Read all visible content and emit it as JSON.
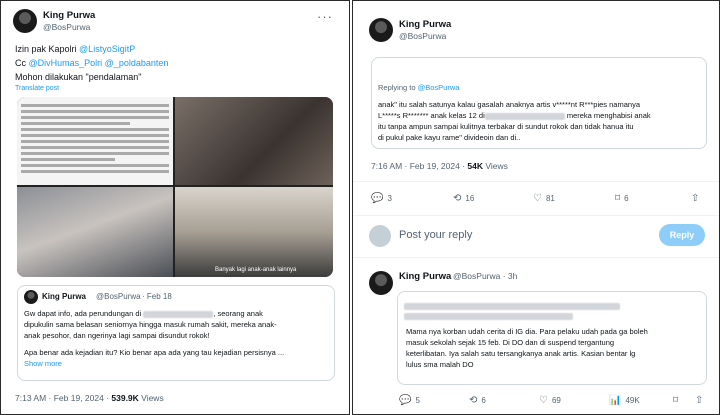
{
  "left": {
    "author": {
      "name": "King Purwa",
      "handle": "@BosPurwa"
    },
    "body": {
      "line1_prefix": "Izin pak Kapolri ",
      "line1_mention": "@ListyoSigitP",
      "line2_prefix": "Cc ",
      "line2_mention1": "@DivHumas_Polri",
      "line2_mention2": "@_poldabanten",
      "line3": "Mohon dilakukan \"pendalaman\""
    },
    "translate_label": "Translate post",
    "image_caption": "Banyak lagi anak-anak lainnya",
    "quote": {
      "name": "King Purwa",
      "handle": "@BosPurwa",
      "date": "· Feb 18",
      "l1a": "Gw dapat info, ada perundungan di",
      "l1b": ", seorang anak",
      "l2": "dipukulin sama belasan seniornya hingga masuk rumah sakit, mereka anak-",
      "l3": "anak pesohor, dan ngerinya lagi sampai disundut rokok!",
      "l4": "Apa benar ada kejadian itu? Kio benar apa ada yang tau kejadian persisnya ...",
      "show_more": "Show more"
    },
    "footer": {
      "time": "7:13 AM · Feb 19, 2024 · ",
      "views": "539.9K",
      "views_label": " Views"
    }
  },
  "right": {
    "author": {
      "name": "King Purwa",
      "handle": "@BosPurwa"
    },
    "reply_box": {
      "replying_prefix": "Replying to ",
      "replying_handle": "@BosPurwa",
      "l1": "anak\" itu salah satunya kalau gasalah anaknya artis v*****nt R***pies namanya",
      "l2a": "L*****s R******* anak kelas 12 di",
      "l2b": " mereka menghabisi anak",
      "l3": "itu tanpa ampun sampai kulitnya terbakar di sundut rokok dan tidak hanua itu",
      "l4": "di pukul pake kayu rame\" divideoin dan di.."
    },
    "footer": {
      "time": "7:16 AM · Feb 19, 2024 · ",
      "views": "54K",
      "views_label": " Views"
    },
    "actions": {
      "replies": "3",
      "reposts": "16",
      "likes": "81",
      "bookmarks": "6"
    },
    "compose": {
      "placeholder": "Post your reply",
      "button": "Reply"
    },
    "reply2": {
      "name": "King Purwa",
      "handle": "@BosPurwa · 3h",
      "l1": "Mama nya korban udah cerita di IG dia. Para pelaku udah pada ga boleh",
      "l2": "masuk sekolah sejak 15 feb. Di DO dan di suspend tergantung",
      "l3": "keterlibatan. Iya salah satu tersangkanya anak artis. Kasian bentar lg",
      "l4": "lulus sma malah DO",
      "actions": {
        "replies": "5",
        "reposts": "6",
        "likes": "69",
        "views": "49K"
      }
    }
  },
  "icons": {
    "more": "···",
    "reply": "💬",
    "repost": "⟲",
    "like": "♡",
    "bookmark": "⌑",
    "share": "⇧",
    "views": "📊"
  }
}
